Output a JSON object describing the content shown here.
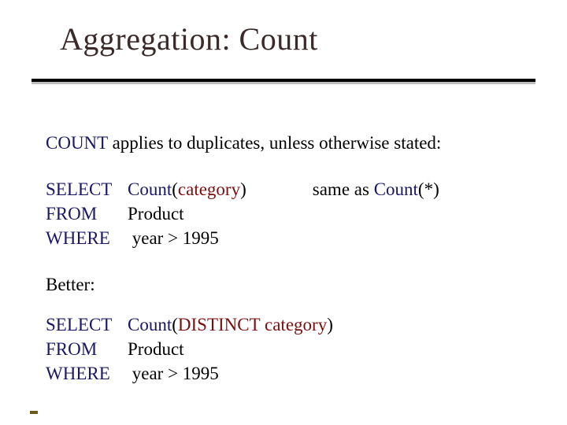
{
  "title": "Aggregation: Count",
  "intro": {
    "kw": "COUNT",
    "text": "   applies to duplicates, unless otherwise stated:"
  },
  "q1": {
    "select_kw": "SELECT",
    "count_kw": "Count",
    "lparen": "(",
    "arg": "category",
    "rparen": ")",
    "annot_prefix": "same as ",
    "annot_count_kw": "Count",
    "annot_suffix": "(*)",
    "from_kw": "FROM",
    "from_val": "Product",
    "where_kw": "WHERE",
    "where_val": " year > 1995"
  },
  "better_label": "Better:",
  "q2": {
    "select_kw": "SELECT",
    "count_kw": "Count",
    "lparen": "(",
    "distinct_kw": "DISTINCT",
    "sp": " ",
    "arg": "category",
    "rparen": ")",
    "from_kw": "FROM",
    "from_val": "Product",
    "where_kw": "WHERE",
    "where_val": " year > 1995"
  }
}
